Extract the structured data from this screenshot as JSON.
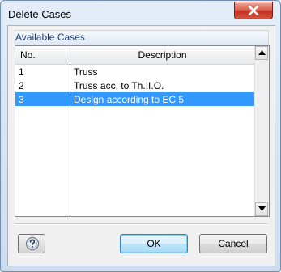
{
  "window": {
    "title": "Delete Cases"
  },
  "group": {
    "title": "Available Cases"
  },
  "table": {
    "columns": [
      "No.",
      "Description"
    ],
    "rows": [
      {
        "no": "1",
        "description": "Truss",
        "selected": false
      },
      {
        "no": "2",
        "description": "Truss acc. to Th.II.O.",
        "selected": false
      },
      {
        "no": "3",
        "description": "Design according to EC 5",
        "selected": true
      }
    ]
  },
  "buttons": {
    "ok": "OK",
    "cancel": "Cancel"
  },
  "icons": {
    "close": "close-icon",
    "help": "help-icon",
    "scroll_up": "arrow-up-icon",
    "scroll_down": "arrow-down-icon"
  },
  "colors": {
    "selection": "#3399ff",
    "close_button": "#c4311f"
  }
}
